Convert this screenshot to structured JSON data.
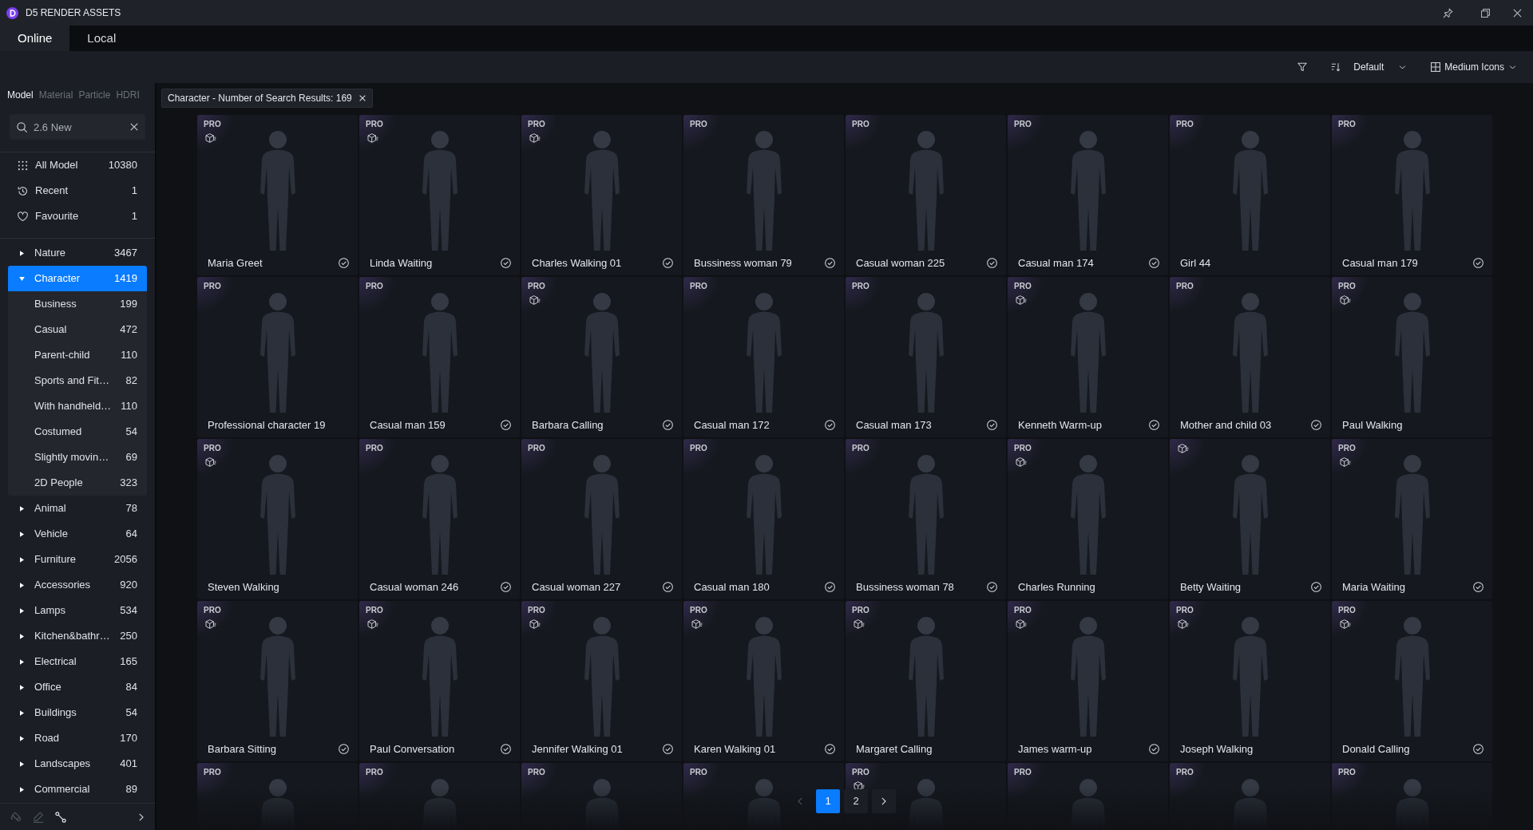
{
  "window": {
    "title": "D5 RENDER ASSETS"
  },
  "tabs": [
    {
      "label": "Online",
      "selected": true
    },
    {
      "label": "Local",
      "selected": false
    }
  ],
  "toolbar": {
    "sort": {
      "value": "Default"
    },
    "view": {
      "value": "Medium Icons"
    }
  },
  "sidebar": {
    "asset_tabs": [
      {
        "label": "Model",
        "selected": true
      },
      {
        "label": "Material",
        "selected": false
      },
      {
        "label": "Particle",
        "selected": false
      },
      {
        "label": "HDRI",
        "selected": false
      }
    ],
    "search": {
      "value": "2.6 New"
    },
    "shortcuts": [
      {
        "kind": "all",
        "label": "All Model",
        "count": "10380",
        "selected": false
      },
      {
        "kind": "recent",
        "label": "Recent",
        "count": "1",
        "selected": false
      },
      {
        "kind": "favourite",
        "label": "Favourite",
        "count": "1",
        "selected": false
      }
    ],
    "categories": [
      {
        "label": "Nature",
        "count": "3467",
        "expanded": false,
        "selected": false
      },
      {
        "label": "Character",
        "count": "1419",
        "expanded": true,
        "selected": true,
        "children": [
          {
            "label": "Business",
            "count": "199",
            "selected": false
          },
          {
            "label": "Casual",
            "count": "472",
            "selected": false
          },
          {
            "label": "Parent-child",
            "count": "110",
            "selected": false
          },
          {
            "label": "Sports and Fit…",
            "count": "82",
            "selected": false
          },
          {
            "label": "With handheld…",
            "count": "110",
            "selected": false
          },
          {
            "label": "Costumed",
            "count": "54",
            "selected": false
          },
          {
            "label": "Slightly movin…",
            "count": "69",
            "selected": false
          },
          {
            "label": "2D People",
            "count": "323",
            "selected": false
          }
        ]
      },
      {
        "label": "Animal",
        "count": "78",
        "expanded": false,
        "selected": false
      },
      {
        "label": "Vehicle",
        "count": "64",
        "expanded": false,
        "selected": false
      },
      {
        "label": "Furniture",
        "count": "2056",
        "expanded": false,
        "selected": false
      },
      {
        "label": "Accessories",
        "count": "920",
        "expanded": false,
        "selected": false
      },
      {
        "label": "Lamps",
        "count": "534",
        "expanded": false,
        "selected": false
      },
      {
        "label": "Kitchen&bathr…",
        "count": "250",
        "expanded": false,
        "selected": false
      },
      {
        "label": "Electrical",
        "count": "165",
        "expanded": false,
        "selected": false
      },
      {
        "label": "Office",
        "count": "84",
        "expanded": false,
        "selected": false
      },
      {
        "label": "Buildings",
        "count": "54",
        "expanded": false,
        "selected": false
      },
      {
        "label": "Road",
        "count": "170",
        "expanded": false,
        "selected": false
      },
      {
        "label": "Landscapes",
        "count": "401",
        "expanded": false,
        "selected": false
      },
      {
        "label": "Commercial",
        "count": "89",
        "expanded": false,
        "selected": false
      }
    ],
    "tools": [
      {
        "kind": "eraser",
        "disabled": true
      },
      {
        "kind": "pencil",
        "disabled": true
      },
      {
        "kind": "link",
        "disabled": false
      }
    ]
  },
  "search_filter": {
    "label": "Character - Number of Search Results: 169"
  },
  "assets": [
    {
      "name": "Maria Greet",
      "badge": "PRO",
      "model": true,
      "downloaded": true
    },
    {
      "name": "Linda Waiting",
      "badge": "PRO",
      "model": true,
      "downloaded": true
    },
    {
      "name": "Charles Walking 01",
      "badge": "PRO",
      "model": true,
      "downloaded": true
    },
    {
      "name": "Bussiness woman 79",
      "badge": "PRO",
      "model": false,
      "downloaded": true
    },
    {
      "name": "Casual woman 225",
      "badge": "PRO",
      "model": false,
      "downloaded": true
    },
    {
      "name": "Casual man 174",
      "badge": "PRO",
      "model": false,
      "downloaded": true
    },
    {
      "name": "Girl 44",
      "badge": "PRO",
      "model": false,
      "downloaded": false
    },
    {
      "name": "Casual man 179",
      "badge": "PRO",
      "model": false,
      "downloaded": true
    },
    {
      "name": "Professional character 19",
      "badge": "PRO",
      "model": false,
      "downloaded": false
    },
    {
      "name": "Casual man 159",
      "badge": "PRO",
      "model": false,
      "downloaded": true
    },
    {
      "name": "Barbara Calling",
      "badge": "PRO",
      "model": true,
      "downloaded": true
    },
    {
      "name": "Casual man 172",
      "badge": "PRO",
      "model": false,
      "downloaded": true
    },
    {
      "name": "Casual man 173",
      "badge": "PRO",
      "model": false,
      "downloaded": true
    },
    {
      "name": "Kenneth Warm-up",
      "badge": "PRO",
      "model": true,
      "downloaded": true
    },
    {
      "name": "Mother and child 03",
      "badge": "PRO",
      "model": false,
      "downloaded": true
    },
    {
      "name": "Paul Walking",
      "badge": "PRO",
      "model": true,
      "downloaded": false
    },
    {
      "name": "Steven Walking",
      "badge": "PRO",
      "model": true,
      "downloaded": false
    },
    {
      "name": "Casual woman 246",
      "badge": "PRO",
      "model": false,
      "downloaded": true
    },
    {
      "name": "Casual woman 227",
      "badge": "PRO",
      "model": false,
      "downloaded": true
    },
    {
      "name": "Casual man 180",
      "badge": "PRO",
      "model": false,
      "downloaded": true
    },
    {
      "name": "Bussiness woman 78",
      "badge": "PRO",
      "model": false,
      "downloaded": true
    },
    {
      "name": "Charles Running",
      "badge": "PRO",
      "model": true,
      "downloaded": false
    },
    {
      "name": "Betty Waiting",
      "model": true,
      "downloaded": true
    },
    {
      "name": "Maria Waiting",
      "badge": "PRO",
      "model": true,
      "downloaded": true
    },
    {
      "name": "Barbara Sitting",
      "badge": "PRO",
      "model": true,
      "downloaded": true
    },
    {
      "name": "Paul Conversation",
      "badge": "PRO",
      "model": true,
      "downloaded": true
    },
    {
      "name": "Jennifer Walking 01",
      "badge": "PRO",
      "model": true,
      "downloaded": true
    },
    {
      "name": "Karen Walking 01",
      "badge": "PRO",
      "model": true,
      "downloaded": true
    },
    {
      "name": "Margaret Calling",
      "badge": "PRO",
      "model": true,
      "downloaded": false
    },
    {
      "name": "James warm-up",
      "badge": "PRO",
      "model": true,
      "downloaded": true
    },
    {
      "name": "Joseph Walking",
      "badge": "PRO",
      "model": true,
      "downloaded": false
    },
    {
      "name": "Donald Calling",
      "badge": "PRO",
      "model": true,
      "downloaded": true
    },
    {
      "badge": "PRO",
      "model": false
    },
    {
      "badge": "PRO",
      "model": false
    },
    {
      "badge": "PRO",
      "model": false
    },
    {
      "badge": "PRO",
      "model": false
    },
    {
      "badge": "PRO",
      "model": true
    },
    {
      "badge": "PRO",
      "model": false
    },
    {
      "badge": "PRO",
      "model": false
    },
    {
      "badge": "PRO",
      "model": false
    }
  ],
  "pagination": {
    "prev": {
      "disabled": true
    },
    "pages": [
      {
        "label": "1",
        "selected": true
      },
      {
        "label": "2",
        "selected": false
      }
    ],
    "next": {
      "disabled": false
    }
  }
}
